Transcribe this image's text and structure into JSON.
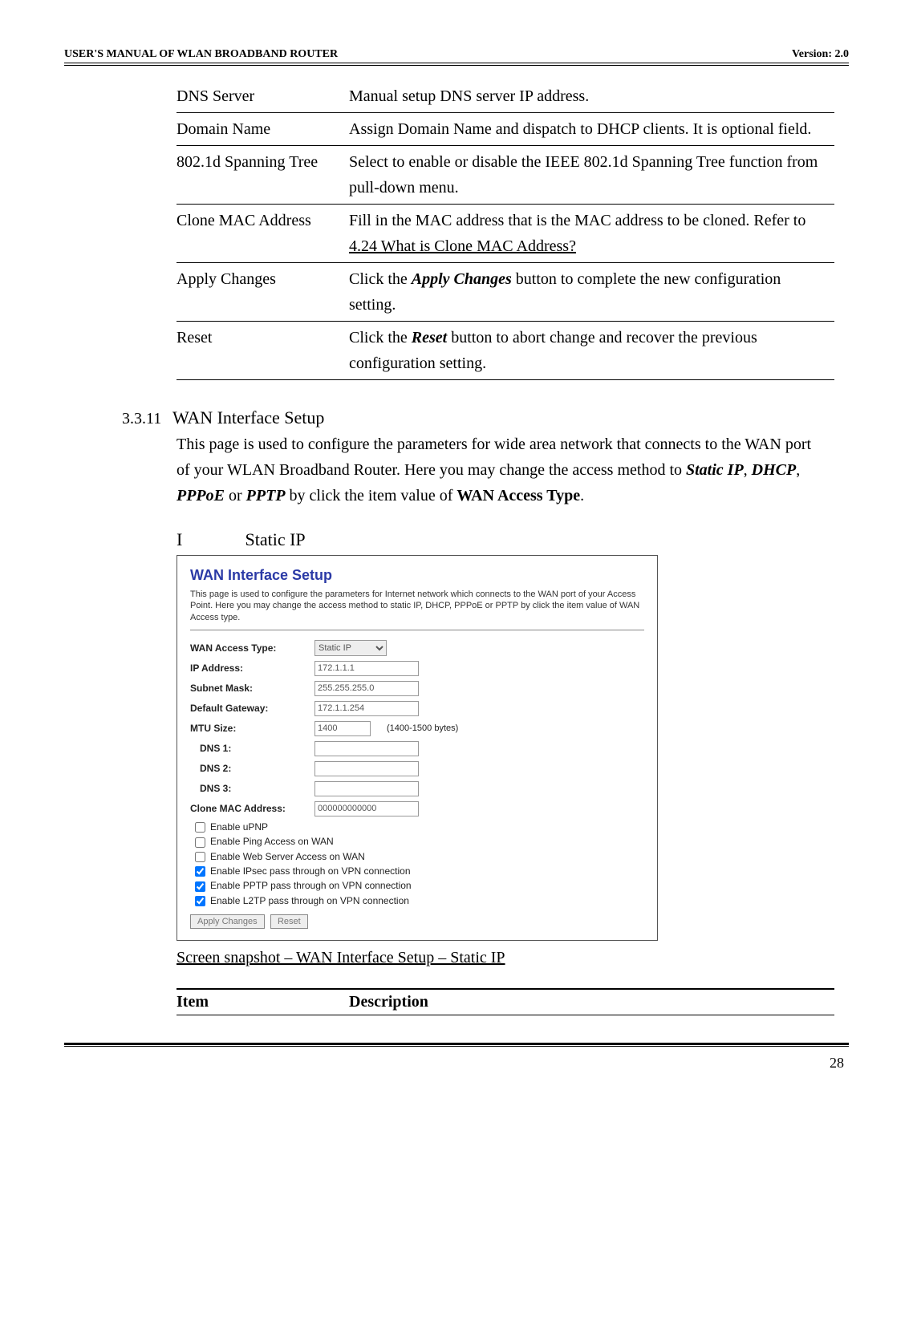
{
  "header": {
    "left": "USER'S MANUAL OF WLAN BROADBAND ROUTER",
    "right": "Version: 2.0"
  },
  "definitions": [
    {
      "term": "DNS Server",
      "desc_pre": "Manual setup DNS server IP address.",
      "desc_post": ""
    },
    {
      "term": "Domain Name",
      "desc_pre": "Assign Domain Name and dispatch to DHCP clients. It is optional field.",
      "desc_post": ""
    },
    {
      "term": "802.1d Spanning Tree",
      "desc_pre": "Select to enable or disable the IEEE 802.1d Spanning Tree function from pull-down menu.",
      "desc_post": ""
    },
    {
      "term": "Clone MAC Address",
      "desc_pre": "Fill in the MAC address that is the MAC address to be cloned. Refer to ",
      "link": "4.24 What is Clone MAC Address?",
      "desc_post": ""
    },
    {
      "term": "Apply Changes",
      "desc_pre": "Click the ",
      "bold": "Apply Changes",
      "desc_post": " button to complete the new configuration setting."
    },
    {
      "term": "Reset",
      "desc_pre": "Click the ",
      "bold": "Reset",
      "desc_post": " button to abort change and recover the previous configuration setting."
    }
  ],
  "section": {
    "number": "3.3.11",
    "title": "WAN Interface Setup",
    "body_pre": "This page is used to configure the parameters for wide area network that connects to the WAN port of your WLAN Broadband Router. Here you may change the access method to ",
    "b1": "Static IP",
    "sep1": ", ",
    "b2": "DHCP",
    "sep2": ", ",
    "b3": "PPPoE",
    "sep3": " or ",
    "b4": "PPTP",
    "body_mid": " by click the item value of ",
    "b5": "WAN Access Type",
    "body_post": "."
  },
  "subsection": {
    "roman": "I",
    "title": "Static IP"
  },
  "shot": {
    "title": "WAN Interface Setup",
    "desc": "This page is used to configure the parameters for Internet network which connects to the WAN port of your Access Point. Here you may change the access method to static IP, DHCP, PPPoE or PPTP by click the item value of WAN Access type.",
    "fields": {
      "access_type_label": "WAN Access Type:",
      "access_type_value": "Static IP",
      "ip_label": "IP Address:",
      "ip_value": "172.1.1.1",
      "mask_label": "Subnet Mask:",
      "mask_value": "255.255.255.0",
      "gw_label": "Default Gateway:",
      "gw_value": "172.1.1.254",
      "mtu_label": "MTU Size:",
      "mtu_value": "1400",
      "mtu_hint": "(1400-1500 bytes)",
      "dns1_label": "DNS 1:",
      "dns2_label": "DNS 2:",
      "dns3_label": "DNS 3:",
      "clone_label": "Clone MAC Address:",
      "clone_value": "000000000000"
    },
    "checks": [
      {
        "label": "Enable uPNP",
        "checked": false
      },
      {
        "label": "Enable Ping Access on WAN",
        "checked": false
      },
      {
        "label": "Enable Web Server Access on WAN",
        "checked": false
      },
      {
        "label": "Enable IPsec pass through on VPN connection",
        "checked": true
      },
      {
        "label": "Enable PPTP pass through on VPN connection",
        "checked": true
      },
      {
        "label": "Enable L2TP pass through on VPN connection",
        "checked": true
      }
    ],
    "buttons": {
      "apply": "Apply Changes",
      "reset": "Reset"
    }
  },
  "caption": "Screen snapshot – WAN Interface Setup – Static IP",
  "table_head": {
    "c1": "Item",
    "c2": "Description"
  },
  "page_number": "28"
}
